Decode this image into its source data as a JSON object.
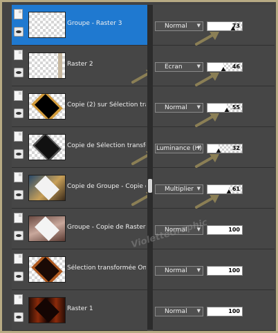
{
  "layers": [
    {
      "name": "Groupe - Raster 3",
      "blend": "Normal",
      "opacity": 73,
      "selected": true,
      "thumb": "checker",
      "icons": [
        "doc-icon",
        "eye-icon"
      ]
    },
    {
      "name": "Raster 2",
      "blend": "Ecran",
      "opacity": 46,
      "selected": false,
      "thumb": "strip",
      "icons": [
        "doc-icon",
        "eye-icon"
      ]
    },
    {
      "name": "Copie (2) sur Sélection trans",
      "blend": "Normal",
      "opacity": 55,
      "selected": false,
      "thumb": "gold",
      "icons": [
        "doc-icon",
        "eye-icon"
      ]
    },
    {
      "name": "Copie de Sélection transform",
      "blend": "Luminance (H)",
      "opacity": 32,
      "selected": false,
      "thumb": "dark",
      "icons": [
        "doc-icon",
        "eye-icon"
      ]
    },
    {
      "name": "Copie de Groupe - Copie de",
      "blend": "Multiplier",
      "opacity": 61,
      "selected": false,
      "thumb": "photo",
      "icons": [
        "doc-icon",
        "eye-icon"
      ]
    },
    {
      "name": "Groupe - Copie de Raster 1",
      "blend": "Normal",
      "opacity": 100,
      "selected": false,
      "thumb": "rose",
      "icons": [
        "doc-icon",
        "eye-icon"
      ]
    },
    {
      "name": "Sélection transformée Omb",
      "blend": "Normal",
      "opacity": 100,
      "selected": false,
      "thumb": "ember",
      "icons": [
        "doc-icon",
        "eye-icon"
      ]
    },
    {
      "name": "Raster 1",
      "blend": "Normal",
      "opacity": 100,
      "selected": false,
      "thumb": "raster",
      "icons": [
        "doc-icon",
        "eye-icon"
      ]
    }
  ],
  "annotations": {
    "arrow_color": "#8b7f55",
    "highlighted_blend_rows": [
      1,
      3,
      4
    ],
    "highlighted_opacity_rows": [
      0,
      1,
      2,
      3,
      4
    ]
  },
  "watermark": "VioletteGraphic",
  "colors": {
    "selected_row": "#1f79d0",
    "frame_border": "#b8ab84"
  }
}
